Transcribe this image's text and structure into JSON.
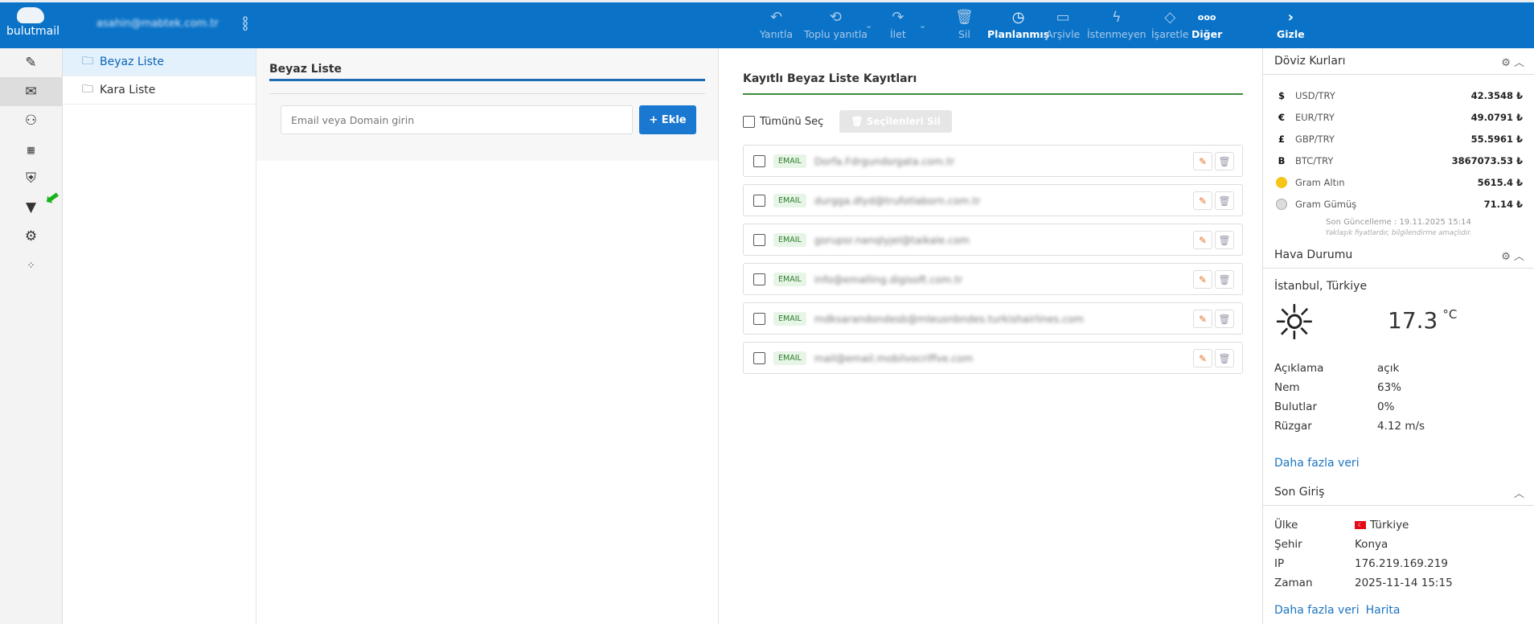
{
  "header": {
    "brand": "bulutmail",
    "account": "asahin@mabtek.com.tr",
    "toolbar": [
      {
        "id": "reply",
        "label": "Yanıtla",
        "icon": "reply-icon",
        "glyph": "↶"
      },
      {
        "id": "reply-all",
        "label": "Toplu yanıtla",
        "icon": "reply-all-icon",
        "glyph": "⟲"
      },
      {
        "id": "forward",
        "label": "İlet",
        "icon": "forward-icon",
        "glyph": "↷"
      },
      {
        "id": "delete",
        "label": "Sil",
        "icon": "trash-icon",
        "glyph": "🗑"
      },
      {
        "id": "scheduled",
        "label": "Planlanmış",
        "icon": "clock-icon",
        "glyph": "◷"
      },
      {
        "id": "archive",
        "label": "Arşivle",
        "icon": "archive-icon",
        "glyph": "▭"
      },
      {
        "id": "spam",
        "label": "İstenmeyen",
        "icon": "lightning-icon",
        "glyph": "ϟ"
      },
      {
        "id": "mark",
        "label": "İşaretle",
        "icon": "tag-icon",
        "glyph": "◇"
      },
      {
        "id": "more",
        "label": "Diğer",
        "icon": "more-icon",
        "glyph": "ooo"
      },
      {
        "id": "hide",
        "label": "Gizle",
        "icon": "chevron-right-icon",
        "glyph": "›"
      }
    ]
  },
  "folders": [
    {
      "label": "Beyaz Liste",
      "active": true
    },
    {
      "label": "Kara Liste",
      "active": false
    }
  ],
  "form": {
    "title": "Beyaz Liste",
    "placeholder": "Email veya Domain girin",
    "add_label": "+ Ekle"
  },
  "list": {
    "title": "Kayıtlı Beyaz Liste Kayıtları",
    "select_all": "Tümünü Seç",
    "delete_selected": "Seçilenleri Sil",
    "entries": [
      {
        "type": "EMAIL",
        "value": "Dorfa.Fdrgundsrgata.com.tr"
      },
      {
        "type": "EMAIL",
        "value": "durgga.dlyd@trufotlaborn.com.tr"
      },
      {
        "type": "EMAIL",
        "value": "gorupsr.nanqlyjel@taikale.com"
      },
      {
        "type": "EMAIL",
        "value": "info@emalling.digisoft.com.tr"
      },
      {
        "type": "EMAIL",
        "value": "mdksarandondesb@mleusnbndes.turkishairlines.com"
      },
      {
        "type": "EMAIL",
        "value": "mail@email.mobilvocriffve.com"
      }
    ]
  },
  "currency": {
    "title": "Döviz Kurları",
    "rows": [
      {
        "sym": "$",
        "name": "USD/TRY",
        "value": "42.3548 ₺"
      },
      {
        "sym": "€",
        "name": "EUR/TRY",
        "value": "49.0791 ₺"
      },
      {
        "sym": "£",
        "name": "GBP/TRY",
        "value": "55.5961 ₺"
      },
      {
        "sym": "B",
        "name": "BTC/TRY",
        "value": "3867073.53 ₺"
      },
      {
        "sym": "gold",
        "name": "Gram Altın",
        "value": "5615.4 ₺"
      },
      {
        "sym": "silver",
        "name": "Gram Gümüş",
        "value": "71.14 ₺"
      }
    ],
    "updated": "Son Güncelleme : 19.11.2025 15:14",
    "note": "Yaklaşık fiyatlardır, bilgilendirme amaçlıdır."
  },
  "weather": {
    "title": "Hava Durumu",
    "location": "İstanbul, Türkiye",
    "temp": "17.3",
    "unit": "°C",
    "rows": [
      {
        "k": "Açıklama",
        "v": "açık"
      },
      {
        "k": "Nem",
        "v": "63%"
      },
      {
        "k": "Bulutlar",
        "v": "0%"
      },
      {
        "k": "Rüzgar",
        "v": "4.12 m/s"
      }
    ],
    "more": "Daha fazla veri"
  },
  "login": {
    "title": "Son Giriş",
    "rows": [
      {
        "k": "Ülke",
        "v": "Türkiye"
      },
      {
        "k": "Şehir",
        "v": "Konya"
      },
      {
        "k": "IP",
        "v": "176.219.169.219"
      },
      {
        "k": "Zaman",
        "v": "2025-11-14 15:15"
      }
    ],
    "more": "Daha fazla veri",
    "map": "Harita"
  },
  "colors": {
    "header": "#0a73c8",
    "accent": "#1b78d0",
    "green": "#3c8a3c"
  }
}
